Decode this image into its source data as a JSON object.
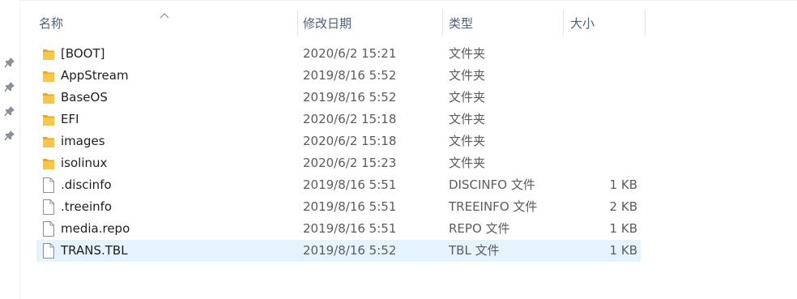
{
  "columns": {
    "name": "名称",
    "date": "修改日期",
    "type": "类型",
    "size": "大小"
  },
  "sort": {
    "column": "name",
    "direction": "ascending"
  },
  "quick_access_pins": [
    "pin-icon",
    "pin-icon",
    "pin-icon",
    "pin-icon"
  ],
  "colors": {
    "folder": "#f8c64a",
    "selected_row": "#e5f3ff",
    "header_text": "#4c607a"
  },
  "files": [
    {
      "name": "[BOOT]",
      "date": "2020/6/2 15:21",
      "type": "文件夹",
      "size": "",
      "icon": "folder-icon",
      "selected": false
    },
    {
      "name": "AppStream",
      "date": "2019/8/16 5:52",
      "type": "文件夹",
      "size": "",
      "icon": "folder-icon",
      "selected": false
    },
    {
      "name": "BaseOS",
      "date": "2019/8/16 5:52",
      "type": "文件夹",
      "size": "",
      "icon": "folder-icon",
      "selected": false
    },
    {
      "name": "EFI",
      "date": "2020/6/2 15:18",
      "type": "文件夹",
      "size": "",
      "icon": "folder-icon",
      "selected": false
    },
    {
      "name": "images",
      "date": "2020/6/2 15:18",
      "type": "文件夹",
      "size": "",
      "icon": "folder-icon",
      "selected": false
    },
    {
      "name": "isolinux",
      "date": "2020/6/2 15:23",
      "type": "文件夹",
      "size": "",
      "icon": "folder-icon",
      "selected": false
    },
    {
      "name": ".discinfo",
      "date": "2019/8/16 5:51",
      "type": "DISCINFO 文件",
      "size": "1 KB",
      "icon": "file-icon",
      "selected": false
    },
    {
      "name": ".treeinfo",
      "date": "2019/8/16 5:51",
      "type": "TREEINFO 文件",
      "size": "2 KB",
      "icon": "file-icon",
      "selected": false
    },
    {
      "name": "media.repo",
      "date": "2019/8/16 5:51",
      "type": "REPO 文件",
      "size": "1 KB",
      "icon": "file-icon",
      "selected": false
    },
    {
      "name": "TRANS.TBL",
      "date": "2019/8/16 5:52",
      "type": "TBL 文件",
      "size": "1 KB",
      "icon": "file-icon",
      "selected": true
    }
  ]
}
